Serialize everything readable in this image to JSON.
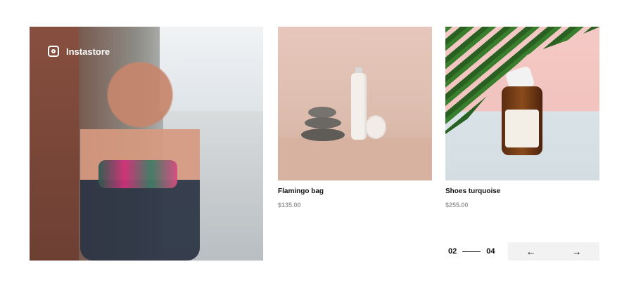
{
  "brand": {
    "name": "Instastore",
    "icon": "instagram-icon"
  },
  "products": [
    {
      "title": "Flamingo bag",
      "price": "$135.00"
    },
    {
      "title": "Shoes turquoise",
      "price": "$255.00"
    }
  ],
  "pager": {
    "current": "02",
    "total": "04"
  },
  "nav": {
    "prev_icon": "←",
    "next_icon": "→"
  }
}
